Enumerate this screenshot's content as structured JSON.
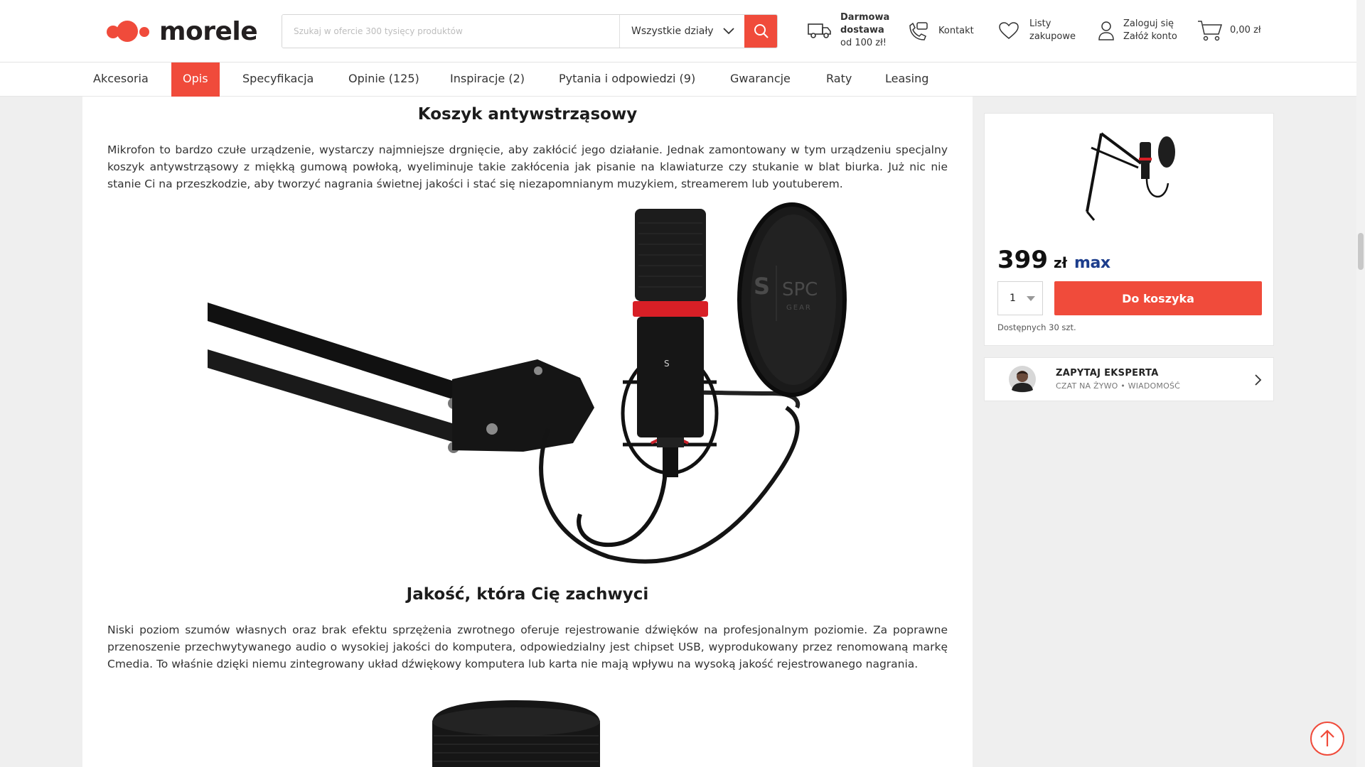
{
  "header": {
    "logo_text": "morele",
    "search_placeholder": "Szukaj w ofercie 300 tysięcy produktów",
    "department": "Wszystkie działy",
    "delivery": {
      "line1": "Darmowa",
      "line2": "dostawa",
      "line3": "od 100 zł!"
    },
    "contact_label": "Kontakt",
    "lists": {
      "line1": "Listy",
      "line2": "zakupowe"
    },
    "account": {
      "line1": "Zaloguj się",
      "line2": "Załóż konto"
    },
    "cart_total": "0,00 zł"
  },
  "subnav": {
    "tabs": [
      {
        "label": "Akcesoria",
        "active": false
      },
      {
        "label": "Opis",
        "active": true
      },
      {
        "label": "Specyfikacja",
        "active": false
      },
      {
        "label": "Opinie (125)",
        "active": false
      },
      {
        "label": "Inspiracje (2)",
        "active": false
      },
      {
        "label": "Pytania i odpowiedzi (9)",
        "active": false
      },
      {
        "label": "Gwarancje",
        "active": false
      },
      {
        "label": "Raty",
        "active": false
      },
      {
        "label": "Leasing",
        "active": false
      }
    ]
  },
  "content": {
    "section1": {
      "heading": "Koszyk antywstrząsowy",
      "text": "Mikrofon to bardzo czułe urządzenie, wystarczy najmniejsze drgnięcie, aby zakłócić jego działanie. Jednak zamontowany w tym urządzeniu specjalny koszyk antywstrząsowy z miękką gumową powłoką, wyeliminuje takie zakłócenia jak pisanie na klawiaturze czy stukanie w blat biurka. Już nic nie stanie Ci na przeszkodzie, aby tworzyć nagrania świetnej jakości i stać się niezapomnianym muzykiem, streamerem lub youtuberem."
    },
    "pop_filter_brand": {
      "line1": "SPC",
      "line2": "GEAR"
    },
    "section2": {
      "heading": "Jakość, która Cię zachwyci",
      "text": "Niski poziom szumów własnych oraz brak efektu sprzężenia zwrotnego oferuje rejestrowanie dźwięków na profesjonalnym poziomie. Za poprawne przenoszenie przechwytywanego audio o wysokiej jakości do komputera, odpowiedzialny jest chipset USB, wyprodukowany przez renomowaną markę Cmedia. To właśnie dzięki niemu zintegrowany układ dźwiękowy komputera lub karta nie mają wpływu na wysoką jakość rejestrowanego nagrania."
    }
  },
  "buy_panel": {
    "price": "399",
    "currency": "zł",
    "max_badge": "max",
    "quantity": "1",
    "add_to_cart": "Do koszyka",
    "availability": "Dostępnych 30 szt."
  },
  "expert": {
    "title": "ZAPYTAJ EKSPERTA",
    "subtitle": "CZAT NA ŻYWO • WIADOMOŚĆ"
  },
  "colors": {
    "accent": "#f04b3b",
    "max_blue": "#1c3d8c"
  }
}
